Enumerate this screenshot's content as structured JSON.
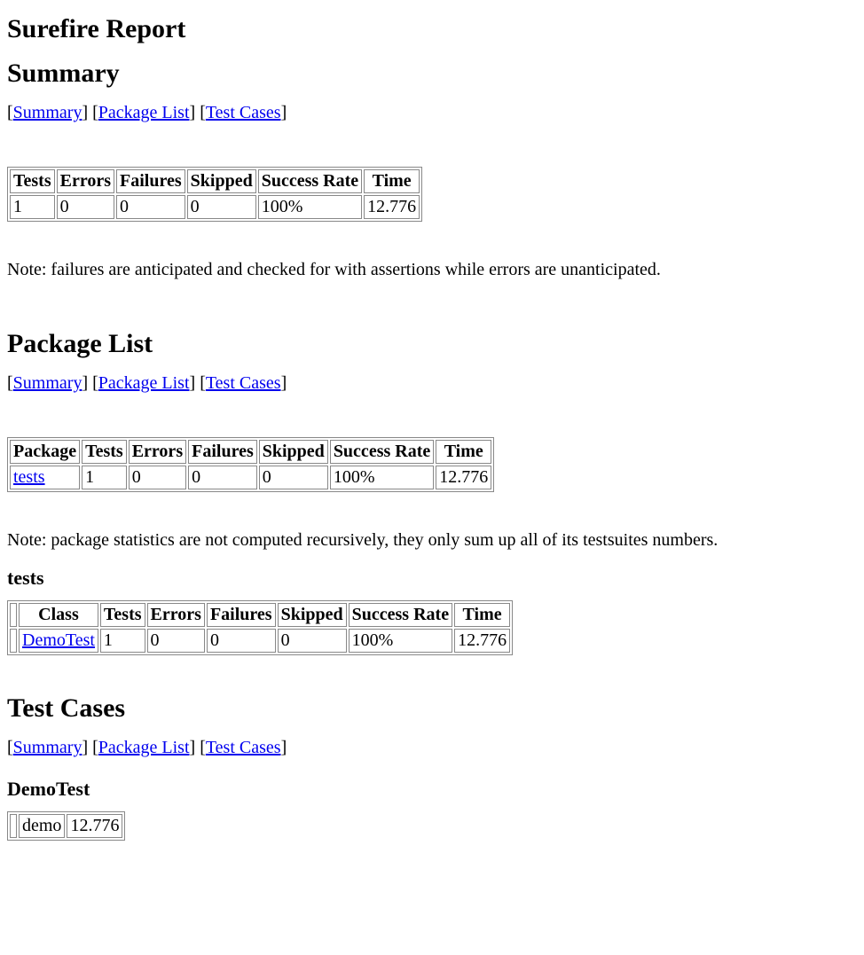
{
  "page_title": "Surefire Report",
  "nav": {
    "summary": "Summary",
    "package_list": "Package List",
    "test_cases": "Test Cases"
  },
  "sections": {
    "summary": {
      "heading": "Summary",
      "note": "Note: failures are anticipated and checked for with assertions while errors are unanticipated.",
      "table": {
        "headers": [
          "Tests",
          "Errors",
          "Failures",
          "Skipped",
          "Success Rate",
          "Time"
        ],
        "row": {
          "tests": "1",
          "errors": "0",
          "failures": "0",
          "skipped": "0",
          "success_rate": "100%",
          "time": "12.776"
        }
      }
    },
    "package_list": {
      "heading": "Package List",
      "note": "Note: package statistics are not computed recursively, they only sum up all of its testsuites numbers.",
      "table": {
        "headers": [
          "Package",
          "Tests",
          "Errors",
          "Failures",
          "Skipped",
          "Success Rate",
          "Time"
        ],
        "row": {
          "package": "tests",
          "tests": "1",
          "errors": "0",
          "failures": "0",
          "skipped": "0",
          "success_rate": "100%",
          "time": "12.776"
        }
      },
      "sub_heading": "tests",
      "class_table": {
        "headers": [
          "",
          "Class",
          "Tests",
          "Errors",
          "Failures",
          "Skipped",
          "Success Rate",
          "Time"
        ],
        "row": {
          "blank": "",
          "class": "DemoTest",
          "tests": "1",
          "errors": "0",
          "failures": "0",
          "skipped": "0",
          "success_rate": "100%",
          "time": "12.776"
        }
      }
    },
    "test_cases": {
      "heading": "Test Cases",
      "sub_heading": "DemoTest",
      "table": {
        "row": {
          "blank": "",
          "name": "demo",
          "time": "12.776"
        }
      }
    }
  }
}
